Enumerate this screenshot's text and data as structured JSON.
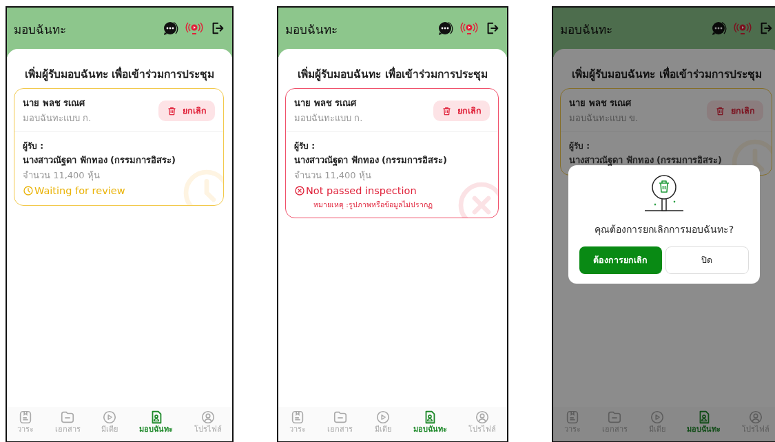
{
  "screens": [
    {
      "header": {
        "title": "มอบฉันทะ"
      },
      "heading": "เพิ่มผู้รับมอบฉันทะ เพื่อเข้าร่วมการประชุม",
      "card": {
        "kind": "pending",
        "name": "นาย พลช รเณศ",
        "proxy_type": "มอบฉันทะแบบ ก.",
        "cancel_label": "ยกเลิก",
        "recipient_label": "ผู้รับ :",
        "recipient_name": "นางสาวณัฐดา ฟักทอง (กรรมการอิสระ)",
        "amount": "จำนวน 11,400 หุ้น",
        "status_text": "Waiting for review"
      },
      "nav": [
        {
          "label": "วาระ",
          "selected": false
        },
        {
          "label": "เอกสาร",
          "selected": false
        },
        {
          "label": "มีเดีย",
          "selected": false
        },
        {
          "label": "มอบฉันทะ",
          "selected": true
        },
        {
          "label": "โปรไฟล์",
          "selected": false
        }
      ]
    },
    {
      "header": {
        "title": "มอบฉันทะ"
      },
      "heading": "เพิ่มผู้รับมอบฉันทะ เพื่อเข้าร่วมการประชุม",
      "card": {
        "kind": "rejected",
        "name": "นาย พลช รเณศ",
        "proxy_type": "มอบฉันทะแบบ ก.",
        "cancel_label": "ยกเลิก",
        "recipient_label": "ผู้รับ :",
        "recipient_name": "นางสาวณัฐดา ฟักทอง (กรรมการอิสระ)",
        "amount": "จำนวน 11,400 หุ้น",
        "status_text": "Not passed inspection",
        "note": "หมายเหตุ :รูปภาพหรือข้อมูลไม่ปรากฏ"
      },
      "nav": [
        {
          "label": "วาระ",
          "selected": false
        },
        {
          "label": "เอกสาร",
          "selected": false
        },
        {
          "label": "มีเดีย",
          "selected": false
        },
        {
          "label": "มอบฉันทะ",
          "selected": true
        },
        {
          "label": "โปรไฟล์",
          "selected": false
        }
      ]
    },
    {
      "header": {
        "title": "มอบฉันทะ"
      },
      "heading": "เพิ่มผู้รับมอบฉันทะ เพื่อเข้าร่วมการประชุม",
      "card": {
        "kind": "pending",
        "name": "นาย พลช รเณศ",
        "proxy_type": "มอบฉันทะแบบ ข.",
        "cancel_label": "ยกเลิก",
        "recipient_label": "ผู้รับ :",
        "recipient_name": "นางสาวณัฐดา ฟักทอง (กรรมการอิสระ)"
      },
      "nav": [
        {
          "label": "วาระ",
          "selected": false
        },
        {
          "label": "เอกสาร",
          "selected": false
        },
        {
          "label": "มีเดีย",
          "selected": false
        },
        {
          "label": "มอบฉันทะ",
          "selected": true
        },
        {
          "label": "โปรไฟล์",
          "selected": false
        }
      ],
      "dialog": {
        "question": "คุณต้องการยกเลิกการมอบฉันทะ?",
        "confirm_label": "ต้องการยกเลิก",
        "close_label": "ปิด"
      }
    }
  ]
}
